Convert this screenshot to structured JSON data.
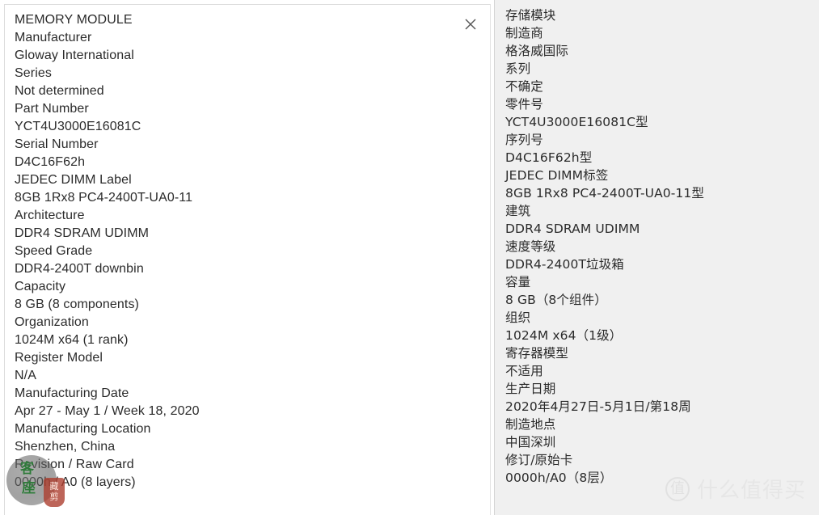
{
  "window": {
    "title": "MEMORY MODULE",
    "close_icon": "close-icon"
  },
  "colors": {
    "left_panel_bg": "#ffffff",
    "right_panel_bg": "#f0f0f0",
    "text": "#2b2b2b",
    "divider": "#d4d4d4",
    "seal_green": "#2f7a3a",
    "seal_red": "#ac3e30"
  },
  "source": {
    "lines": [
      "MEMORY MODULE",
      "Manufacturer",
      "Gloway International",
      "Series",
      "Not determined",
      "Part Number",
      "YCT4U3000E16081C",
      "Serial Number",
      "D4C16F62h",
      "JEDEC DIMM Label",
      "8GB 1Rx8 PC4-2400T-UA0-11",
      "Architecture",
      "DDR4 SDRAM UDIMM",
      "Speed Grade",
      "DDR4-2400T downbin",
      "Capacity",
      "8 GB (8 components)",
      "Organization",
      "1024M x64 (1 rank)",
      "Register Model",
      "N/A",
      "Manufacturing Date",
      "Apr 27 - May 1 / Week 18, 2020",
      "Manufacturing Location",
      "Shenzhen, China",
      "Revision / Raw Card",
      "0000h / A0 (8 layers)"
    ]
  },
  "translation": {
    "lines": [
      "存储模块",
      "制造商",
      "格洛威国际",
      "系列",
      "不确定",
      "零件号",
      "YCT4U3000E16081C型",
      "序列号",
      "D4C16F62h型",
      "JEDEC DIMM标签",
      "8GB 1Rx8 PC4-2400T-UA0-11型",
      "建筑",
      "DDR4 SDRAM UDIMM",
      "速度等级",
      "DDR4-2400T垃圾箱",
      "容量",
      "8 GB（8个组件）",
      "组织",
      "1024M x64（1级）",
      "寄存器模型",
      "不适用",
      "生产日期",
      "2020年4月27日-5月1日/第18周",
      "制造地点",
      "中国深圳",
      "修订/原始卡",
      "0000h/A0（8层）"
    ]
  },
  "watermarks": {
    "seal": {
      "char_top": "客",
      "char_bottom": "座",
      "stamp_top": "藏",
      "stamp_bottom": "剪"
    },
    "smzdm": {
      "badge": "值",
      "text": "什么值得买"
    }
  }
}
